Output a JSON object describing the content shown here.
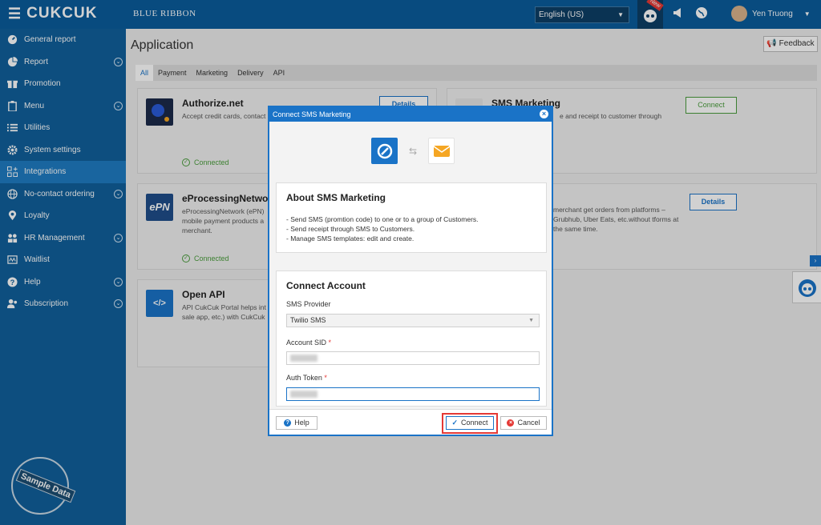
{
  "header": {
    "brand": "CUKCUK",
    "org": "BLUE RIBBON",
    "language": "English (US)",
    "new_badge": "New",
    "user_name": "Yen Truong"
  },
  "sidebar": {
    "items": [
      {
        "label": "General report",
        "icon": "report-icon"
      },
      {
        "label": "Report",
        "icon": "pie-chart-icon"
      },
      {
        "label": "Promotion",
        "icon": "gift-icon"
      },
      {
        "label": "Menu",
        "icon": "clipboard-icon"
      },
      {
        "label": "Utilities",
        "icon": "list-icon"
      },
      {
        "label": "System settings",
        "icon": "gear-icon"
      },
      {
        "label": "Integrations",
        "icon": "integrations-icon"
      },
      {
        "label": "No-contact ordering",
        "icon": "globe-icon"
      },
      {
        "label": "Loyalty",
        "icon": "location-icon"
      },
      {
        "label": "HR Management",
        "icon": "people-icon"
      },
      {
        "label": "Waitlist",
        "icon": "waitlist-icon"
      },
      {
        "label": "Help",
        "icon": "help-icon"
      },
      {
        "label": "Subscription",
        "icon": "users-icon"
      }
    ],
    "sample_badge": "Sample Data"
  },
  "main": {
    "title": "Application",
    "feedback": "Feedback",
    "tabs": [
      "All",
      "Payment",
      "Marketing",
      "Delivery",
      "API"
    ],
    "cards": [
      {
        "name": "Authorize.net",
        "desc": "Accept credit cards, contact person and on the go.",
        "status": "Connected",
        "button": "Details"
      },
      {
        "name": "SMS Marketing",
        "desc": "e and receipt to customer through",
        "button": "Connect"
      },
      {
        "name": "eProcessingNetwor",
        "desc": "eProcessingNetwork (ePN) mobile payment products a merchant.",
        "status": "Connected",
        "logo_text": "ePN"
      },
      {
        "name": "",
        "desc": "merchant get orders from platforms – Grubhub, Uber Eats, etc.without tforms at the same time.",
        "button": "Details"
      },
      {
        "name": "Open API",
        "desc": "API CukCuk Portal helps int sale app, etc.) with CukCuk",
        "logo_text": "</>"
      }
    ]
  },
  "dialog": {
    "title": "Connect SMS Marketing",
    "about_title": "About SMS Marketing",
    "about_lines": [
      "- Send SMS (promtion code) to one or to a group of Customers.",
      "- Send receipt through SMS to Customers.",
      "- Manage SMS templates: edit and create."
    ],
    "connect_title": "Connect Account",
    "provider_label": "SMS Provider",
    "provider_value": "Twilio SMS",
    "sid_label": "Account SID",
    "token_label": "Auth Token",
    "required_mark": "*",
    "help": "Help",
    "connect": "Connect",
    "cancel": "Cancel"
  },
  "colors": {
    "primary": "#1a73c7",
    "sidebar": "#10609c",
    "topbar": "#0a5c9c",
    "success": "#4a9d3c",
    "danger": "#e53935"
  }
}
